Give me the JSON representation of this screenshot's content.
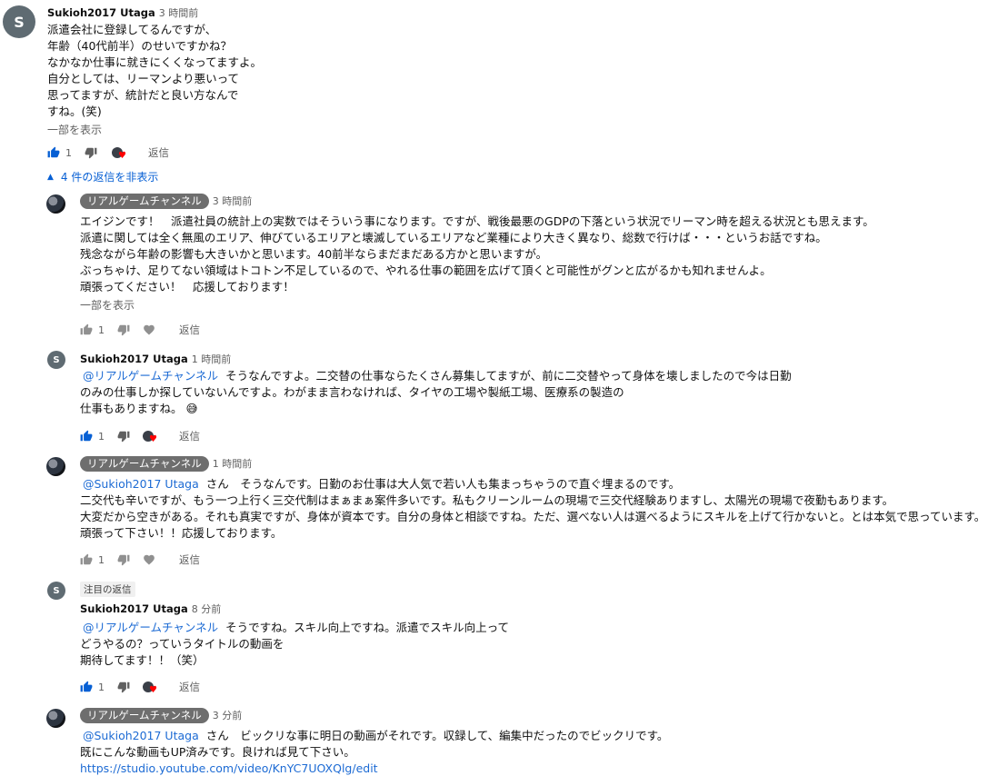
{
  "top_comment": {
    "avatar_letter": "S",
    "author": "Sukioh2017 Utaga",
    "time": "3 時間前",
    "lines": [
      "派遣会社に登録してるんですが、",
      "年齢（40代前半）のせいですかね？",
      "なかなか仕事に就きにくくなってますよ。",
      "自分としては、リーマンより悪いって",
      "思ってますが、統計だと良い方なんで",
      "すね。(笑)"
    ],
    "show_more": "一部を表示",
    "likes": "1",
    "reply": "返信"
  },
  "replies_toggle": "4 件の返信を非表示",
  "replies": [
    {
      "author": "リアルゲームチャンネル",
      "time": "3 時間前",
      "lines": [
        "エイジンです！　派遣社員の統計上の実数ではそういう事になります。ですが、戦後最悪のGDPの下落という状況でリーマン時を超える状況とも思えます。",
        "派遣に関しては全く無風のエリア、伸びているエリアと壊滅しているエリアなど業種により大きく異なり、総数で行けば・・・というお話ですね。",
        "残念ながら年齢の影響も大きいかと思います。40前半ならまだまだある方かと思いますが。",
        "ぶっちゃけ、足りてない領域はトコトン不足しているので、やれる仕事の範囲を広げて頂くと可能性がグンと広がるかも知れませんよ。",
        "頑張ってください！　応援しております！"
      ],
      "show_more": "一部を表示",
      "likes": "1",
      "reply": "返信"
    },
    {
      "avatar_letter": "S",
      "author": "Sukioh2017 Utaga",
      "time": "1 時間前",
      "mention": "@リアルゲームチャンネル",
      "lines": [
        "そうなんですよ。二交替の仕事ならたくさん募集してますが、前に二交替やって身体を壊しましたので今は日勤",
        "のみの仕事しか探していないんですよ。わがまま言わなければ、タイヤの工場や製紙工場、医療系の製造の",
        "仕事もありますね。"
      ],
      "emoji": "😅",
      "likes": "1",
      "reply": "返信"
    },
    {
      "author": "リアルゲームチャンネル",
      "time": "1 時間前",
      "mention": "@Sukioh2017 Utaga",
      "lines": [
        "さん　そうなんです。日勤のお仕事は大人気で若い人も集まっちゃうので直ぐ埋まるのです。",
        "二交代も辛いですが、もう一つ上行く三交代制はまぁまぁ案件多いです。私もクリーンルームの現場で三交代経験ありますし、太陽光の現場で夜勤もあります。",
        "大変だから空きがある。それも真実ですが、身体が資本です。自分の身体と相談ですね。ただ、選べない人は選べるようにスキルを上げて行かないと。とは本気で思っています。",
        "頑張って下さい！！応援しております。"
      ],
      "likes": "1",
      "reply": "返信"
    },
    {
      "pinned": "注目の返信",
      "avatar_letter": "S",
      "author": "Sukioh2017 Utaga",
      "time": "8 分前",
      "mention": "@リアルゲームチャンネル",
      "lines": [
        "そうですね。スキル向上ですね。派遣でスキル向上って",
        "どうやるの？っていうタイトルの動画を",
        "期待してます！！（笑）"
      ],
      "likes": "1",
      "reply": "返信"
    },
    {
      "author": "リアルゲームチャンネル",
      "time": "3 分前",
      "mention": "@Sukioh2017 Utaga",
      "lines": [
        "さん　ビックリな事に明日の動画がそれです。収録して、編集中だったのでビックリです。",
        "既にこんな動画もUP済みです。良ければ見て下さい。"
      ],
      "link": "https://studio.youtube.com/video/KnYC7UOXQlg/edit"
    }
  ],
  "colors": {
    "link_blue": "#1d6bd4",
    "like_blue": "#065fd4",
    "heart_red": "#ff0000",
    "chip_gray": "#6e6e6e"
  }
}
